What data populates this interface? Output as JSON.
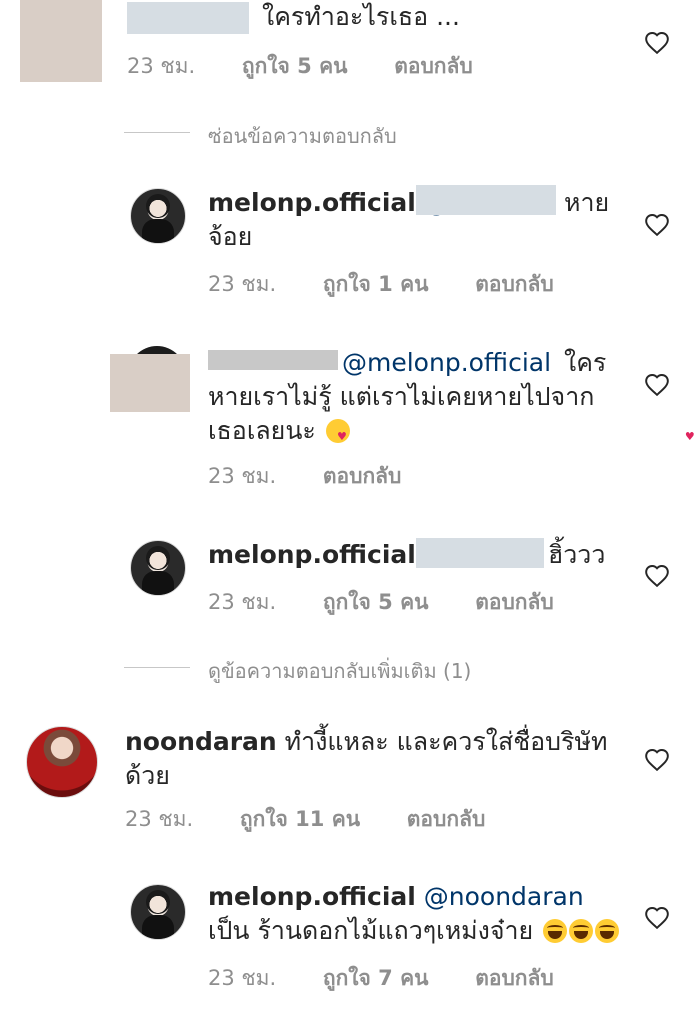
{
  "comments": [
    {
      "id": "c0",
      "text": "ใครทำอะไรเธอ ...",
      "time": "23 ชม.",
      "likes": "ถูกใจ 5 คน",
      "reply": "ตอบกลับ"
    },
    {
      "id": "r1",
      "username": "melonp.official",
      "mention": "@",
      "text": "หาย จ้อย",
      "time": "23 ชม.",
      "likes": "ถูกใจ 1 คน",
      "reply": "ตอบกลับ"
    },
    {
      "id": "r2",
      "username": "",
      "mention": "@melonp.official",
      "text": "ใคร หายเราไม่รู้ แต่เราไม่เคยหายไปจาก เธอเลยนะ",
      "time": "23 ชม.",
      "reply": "ตอบกลับ"
    },
    {
      "id": "r3",
      "username": "melonp.official",
      "mention": "@",
      "text": "ฮิ้ววว",
      "time": "23 ชม.",
      "likes": "ถูกใจ 5 คน",
      "reply": "ตอบกลับ"
    },
    {
      "id": "c1",
      "username": "noondaran",
      "text": "ทำงี้แหละ และควรใส่ชื่อบริษัท ด้วย",
      "time": "23 ชม.",
      "likes": "ถูกใจ 11 คน",
      "reply": "ตอบกลับ"
    },
    {
      "id": "r4",
      "username": "melonp.official",
      "mention": "@noondaran",
      "text": "เป็น ร้านดอกไม้แถวๆเหม่งจ๋าย",
      "time": "23 ชม.",
      "likes": "ถูกใจ 7 คน",
      "reply": "ตอบกลับ"
    }
  ],
  "threads": {
    "hide_replies": "ซ่อนข้อความตอบกลับ",
    "view_more_replies": "ดูข้อความตอบกลับเพิ่มเติม (1)"
  },
  "icons": {
    "like": "heart-outline-icon",
    "emoji_heart_eyes": "smiling-face-with-heart-eyes",
    "emoji_laugh": "rolling-on-the-floor-laughing"
  },
  "colors": {
    "text": "#262626",
    "secondary": "#8e8e8e",
    "mention": "#003569"
  }
}
